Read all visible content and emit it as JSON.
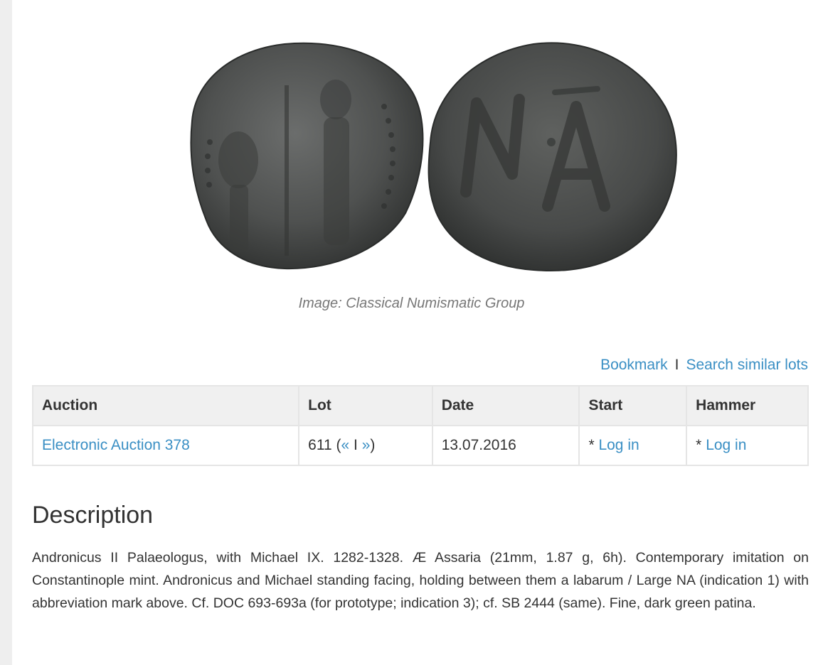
{
  "image_credit": "Image: Classical Numismatic Group",
  "actions": {
    "bookmark": "Bookmark",
    "separator": "I",
    "search_similar": "Search similar lots"
  },
  "table": {
    "headers": [
      "Auction",
      "Lot",
      "Date",
      "Start",
      "Hammer"
    ],
    "row": {
      "auction": "Electronic Auction 378",
      "lot_number": "611",
      "lot_open_paren": "(",
      "lot_prev": "«",
      "lot_sep": "I",
      "lot_next": "»",
      "lot_close_paren": ")",
      "date": "13.07.2016",
      "start_prefix": "* ",
      "start_link": "Log in",
      "hammer_prefix": "* ",
      "hammer_link": "Log in"
    }
  },
  "description": {
    "title": "Description",
    "text": "Andronicus II Palaeologus, with Michael IX. 1282-1328. Æ Assaria (21mm, 1.87 g, 6h). Contemporary imitation on Constantinople mint. Andronicus and Michael standing facing, holding between them a labarum / Large NA (indication 1) with abbreviation mark above. Cf. DOC 693-693a (for prototype; indication 3); cf. SB 2444 (same). Fine, dark green patina."
  },
  "colors": {
    "link": "#3a8fc4",
    "coin": "#4a4c4b",
    "table_header_bg": "#f0f0f0"
  }
}
